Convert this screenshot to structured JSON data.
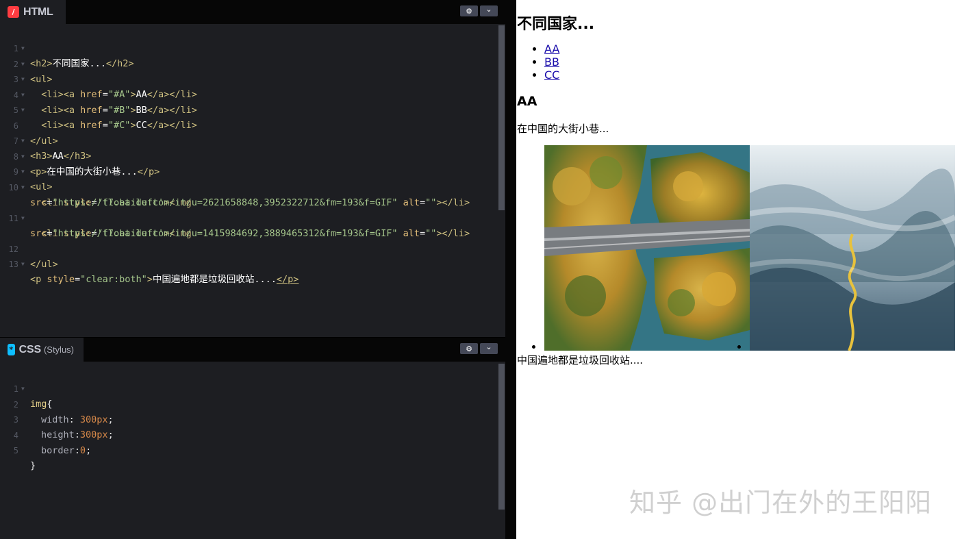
{
  "html_pane": {
    "tab_label": "HTML",
    "icon": "html-icon",
    "lines": [
      {
        "n": "1",
        "fold": true
      },
      {
        "n": "2",
        "fold": true
      },
      {
        "n": "3",
        "fold": true
      },
      {
        "n": "4",
        "fold": true
      },
      {
        "n": "5",
        "fold": true
      },
      {
        "n": "6",
        "fold": false
      },
      {
        "n": "7",
        "fold": true
      },
      {
        "n": "8",
        "fold": true
      },
      {
        "n": "9",
        "fold": true
      },
      {
        "n": "10",
        "fold": true
      },
      {
        "n": "11",
        "fold": true
      },
      {
        "n": "12",
        "fold": false
      },
      {
        "n": "13",
        "fold": true
      }
    ],
    "code": {
      "l1": {
        "open": "<h2>",
        "text": "不同国家...",
        "close": "</h2>"
      },
      "l2": {
        "open": "<ul>"
      },
      "l3": {
        "indent": "  ",
        "li": "<li>",
        "a": "<a ",
        "attr": "href",
        "eq": "=",
        "str": "\"#A\"",
        "gt": ">",
        "text": "AA",
        "close": "</a></li>"
      },
      "l4": {
        "indent": "  ",
        "li": "<li>",
        "a": "<a ",
        "attr": "href",
        "eq": "=",
        "str": "\"#B\"",
        "gt": ">",
        "text": "BB",
        "close": "</a></li>"
      },
      "l5": {
        "indent": "  ",
        "li": "<li>",
        "a": "<a ",
        "attr": "href",
        "eq": "=",
        "str": "\"#C\"",
        "gt": ">",
        "text": "CC",
        "close": "</a></li>"
      },
      "l6": {
        "close": "</ul>"
      },
      "l7": {
        "open": "<h3>",
        "text": "AA",
        "close": "</h3>"
      },
      "l8": {
        "open": "<p>",
        "text": "在中国的大街小巷...",
        "close": "</p>"
      },
      "l9": {
        "open": "<ul>"
      },
      "l10": {
        "indent": "  ",
        "li": "<li ",
        "attr": "style",
        "eq": "=",
        "str": "'float:left'",
        "img": "><img"
      },
      "l10b": {
        "attr": "src",
        "eq": "=",
        "str": "\"https://t7.baidu.com/it/u=2621658848,3952322712&fm=193&f=GIF\"",
        "sp": " ",
        "attr2": "alt",
        "eq2": "=",
        "str2": "\"\"",
        "close": "></li>"
      },
      "l11": {
        "indent": "  ",
        "li": "<li ",
        "attr": "style",
        "eq": "=",
        "str": "'float:left'",
        "img": "><img"
      },
      "l11b": {
        "attr": "src",
        "eq": "=",
        "str": "\"https://t7.baidu.com/it/u=1415984692,3889465312&fm=193&f=GIF\"",
        "sp": " ",
        "attr2": "alt",
        "eq2": "=",
        "str2": "\"\"",
        "close": "></li>"
      },
      "l12": {
        "close": "</ul>"
      },
      "l13": {
        "p": "<p ",
        "attr": "style",
        "eq": "=",
        "str": "\"clear:both\"",
        "gt": ">",
        "text": "中国遍地都是垃圾回收站....",
        "close": "</p>"
      }
    }
  },
  "css_pane": {
    "tab_label": "CSS",
    "tab_sub": "(Stylus)",
    "icon": "css-icon",
    "lines": [
      "1",
      "2",
      "3",
      "4",
      "5"
    ],
    "code": {
      "sel": "img",
      "brace_open": "{",
      "p1": "width",
      "p1sep": ": ",
      "v1": "300px",
      "semi": ";",
      "p2": "height",
      "p2sep": ":",
      "v2": "300px",
      "p3": "border",
      "p3sep": ":",
      "v3": "0",
      "brace_close": "}"
    }
  },
  "buttons": {
    "settings_icon": "gear-icon",
    "collapse_icon": "chevron-down-icon",
    "gear_glyph": "⚙",
    "chev_glyph": "⌄"
  },
  "preview": {
    "h2": "不同国家...",
    "links": [
      "AA",
      "BB",
      "CC"
    ],
    "h3": "AA",
    "p": "在中国的大街小巷...",
    "image1": "aerial-forest-bridge-image",
    "image2": "misty-mountains-river-image",
    "footer_p": "中国遍地都是垃圾回收站....",
    "watermark": "知乎 @出门在外的王阳阳"
  }
}
